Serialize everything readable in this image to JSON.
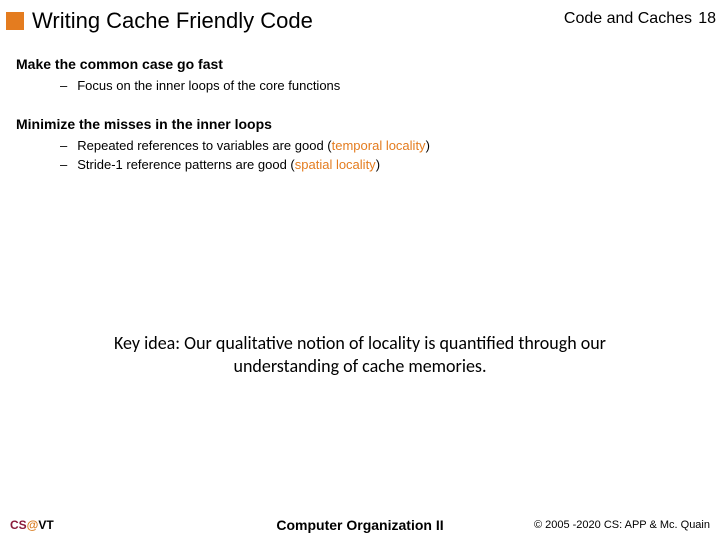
{
  "header": {
    "title": "Writing Cache Friendly Code",
    "section": "Code and Caches",
    "page": "18"
  },
  "content": {
    "heading1": "Make the common case go fast",
    "bullets1": [
      {
        "text": "Focus on the inner loops of the core functions"
      }
    ],
    "heading2": "Minimize the misses in the inner loops",
    "bullets2": [
      {
        "pre": "Repeated references to variables are good (",
        "em": "temporal locality",
        "post": ")"
      },
      {
        "pre": "Stride-1 reference patterns are good (",
        "em": "spatial locality",
        "post": ")"
      }
    ]
  },
  "key_idea": "Key idea: Our qualitative notion of locality is quantified through our understanding of cache memories.",
  "footer": {
    "cs": "CS",
    "at": "@",
    "vt": "VT",
    "center": "Computer Organization II",
    "right": "© 2005 -2020 CS: APP & Mc. Quain"
  }
}
